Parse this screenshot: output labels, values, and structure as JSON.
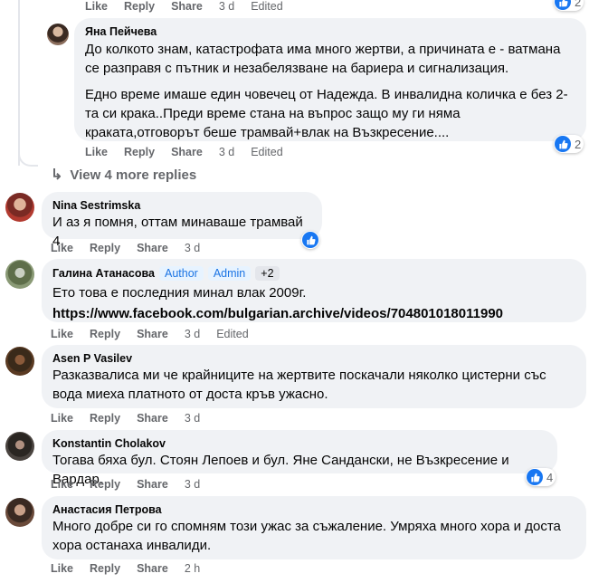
{
  "colors": {
    "bubble_bg": "#f0f2f5",
    "meta_text": "#65676b",
    "link_blue": "#1877f2",
    "badge_text": "#1b74e4",
    "badge_bg": "#e7f3ff"
  },
  "top_actions": {
    "like": "Like",
    "reply": "Reply",
    "share": "Share",
    "time": "3 d",
    "edited": "Edited",
    "reaction_count": "2"
  },
  "comments": [
    {
      "author": "Яна Пейчева",
      "paragraphs": [
        "До колкото знам, катастрофата има много жертви, а причината е - ватмана се разправя с пътник и незабелязване на бариера и сигнализация.",
        "Едно време имаше един човечец от Надежда. В инвалидна количка е без 2-та си крака..Преди време стана на въпрос защо му ги няма краката,отговорът беше трамвай+влак на Възкресение...."
      ],
      "actions": {
        "like": "Like",
        "reply": "Reply",
        "share": "Share",
        "time": "3 d",
        "edited": "Edited"
      },
      "reaction_count": "2",
      "reaction_icon": "like-icon"
    },
    {
      "author": "Nina Sestrimska",
      "text": "И аз я помня, оттам минаваше трамвай 4.",
      "actions": {
        "like": "Like",
        "reply": "Reply",
        "share": "Share",
        "time": "3 d"
      },
      "reaction_icon": "like-icon"
    },
    {
      "author": "Галина Атанасова",
      "badges": [
        "Author",
        "Admin",
        "+2"
      ],
      "text": "Ето това е последния минал влак 2009г.",
      "link": "https://www.facebook.com/bulgarian.archive/videos/704801018011990",
      "actions": {
        "like": "Like",
        "reply": "Reply",
        "share": "Share",
        "time": "3 d",
        "edited": "Edited"
      }
    },
    {
      "author": "Asen P Vasilev",
      "text": "Разказвалиса ми че крайниците на жертвите поскачали няколко цистерни със вода миеха платното от доста кръв ужасно.",
      "actions": {
        "like": "Like",
        "reply": "Reply",
        "share": "Share",
        "time": "3 d"
      }
    },
    {
      "author": "Konstantin Cholakov",
      "text": "Тогава бяха бул. Стоян Лепоев и бул. Яне Сандански, не Възкресение и Вардар.",
      "actions": {
        "like": "Like",
        "reply": "Reply",
        "share": "Share",
        "time": "3 d"
      },
      "reaction_count": "4",
      "reaction_icon": "like-icon"
    },
    {
      "author": "Анастасия Петрова",
      "text": "Много добре си го спомням този ужас за съжаление. Умряха много хора и доста хора останаха инвалиди.",
      "actions": {
        "like": "Like",
        "reply": "Reply",
        "share": "Share",
        "time": "2 h"
      }
    }
  ],
  "view_more_replies": "View 4 more replies"
}
